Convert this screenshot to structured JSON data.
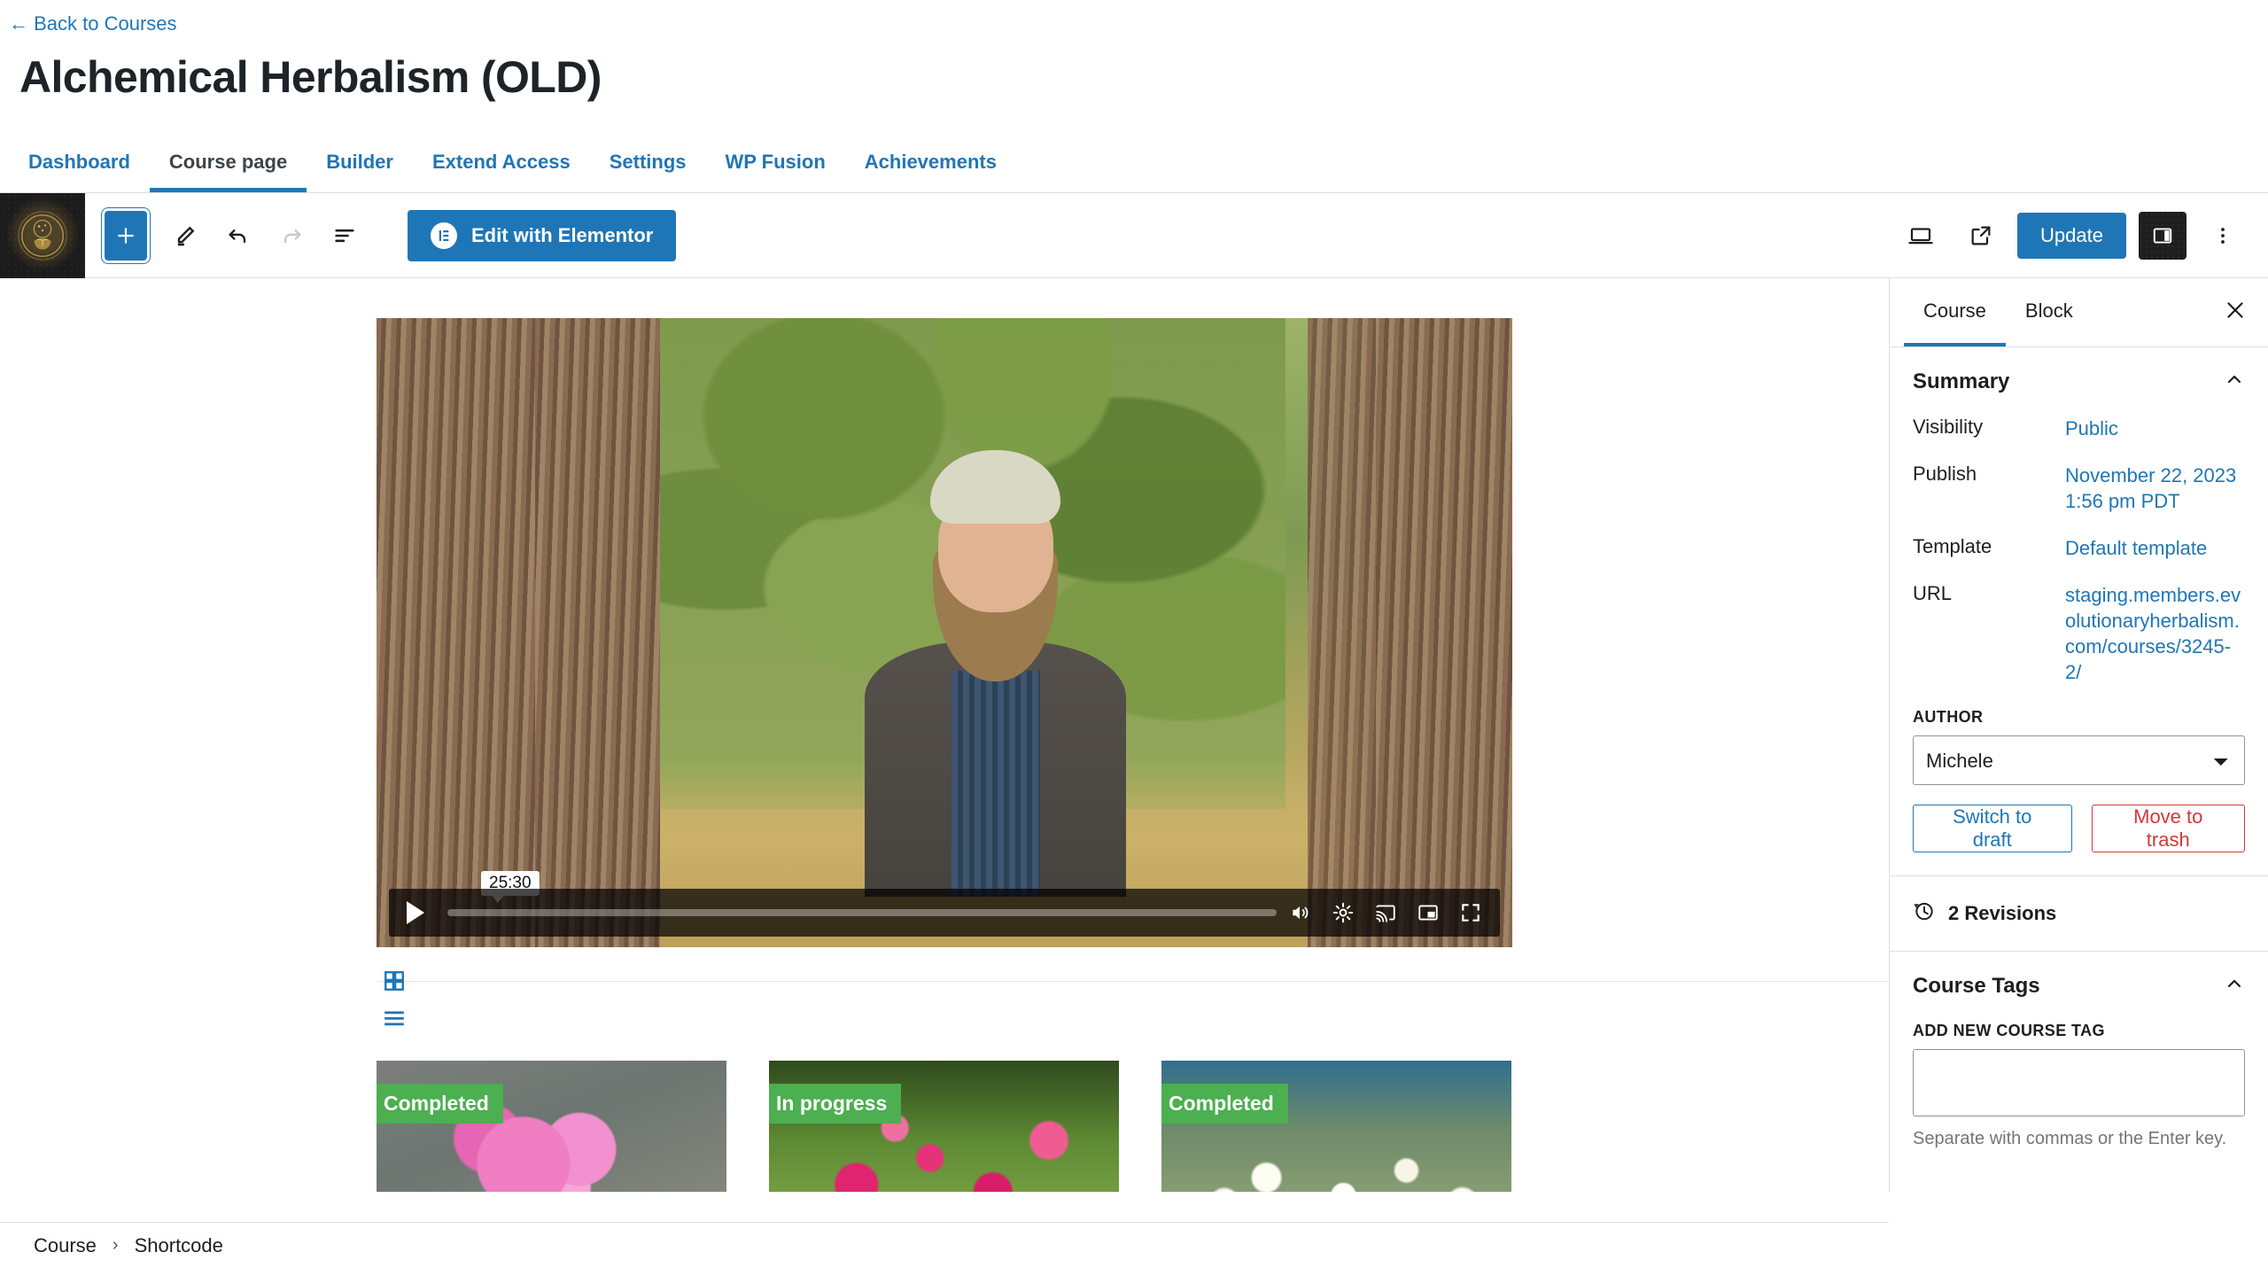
{
  "admin": {
    "back_link": "← Back to Courses",
    "page_title": "Alchemical Herbalism (OLD)",
    "tabs": [
      {
        "label": "Dashboard",
        "active": false
      },
      {
        "label": "Course page",
        "active": true
      },
      {
        "label": "Builder",
        "active": false
      },
      {
        "label": "Extend Access",
        "active": false
      },
      {
        "label": "Settings",
        "active": false
      },
      {
        "label": "WP Fusion",
        "active": false
      },
      {
        "label": "Achievements",
        "active": false
      }
    ]
  },
  "toolbar": {
    "site_icon_name": "site-emblem-icon",
    "add_block_label": "+",
    "tools": [
      "add-block-icon",
      "edit-pencil-icon",
      "undo-icon",
      "redo-icon",
      "list-view-icon"
    ],
    "elementor_button": "Edit with Elementor",
    "preview_icon": "desktop-preview-icon",
    "view_icon": "external-link-icon",
    "update_button": "Update",
    "sidebar_toggle_icon": "settings-sidebar-icon",
    "options_icon": "more-options-icon"
  },
  "canvas": {
    "video": {
      "time_label": "25:30",
      "play_icon": "play-icon",
      "controls": [
        "volume-icon",
        "settings-gear-icon",
        "cast-icon",
        "picture-in-picture-icon",
        "fullscreen-icon"
      ]
    },
    "block_marks": [
      "grid-block-icon",
      "list-block-icon"
    ],
    "cards": [
      {
        "badge": "Completed",
        "photo": "peony"
      },
      {
        "badge": "In progress",
        "photo": "roses"
      },
      {
        "badge": "Completed",
        "photo": "chamomile"
      }
    ]
  },
  "sidebar": {
    "tabs": [
      {
        "label": "Course",
        "active": true
      },
      {
        "label": "Block",
        "active": false
      }
    ],
    "close_icon": "close-icon",
    "summary": {
      "title": "Summary",
      "rows": [
        {
          "label": "Visibility",
          "value": "Public"
        },
        {
          "label": "Publish",
          "value": "November 22, 2023 1:56 pm PDT"
        },
        {
          "label": "Template",
          "value": "Default template"
        },
        {
          "label": "URL",
          "value": "staging.members.evolutionaryherbalism.com/courses/3245-2/"
        }
      ],
      "author_label": "AUTHOR",
      "author_value": "Michele",
      "switch_draft_button": "Switch to draft",
      "move_trash_button": "Move to trash"
    },
    "revisions": {
      "icon": "revision-clock-icon",
      "label": "2 Revisions"
    },
    "course_tags": {
      "title": "Course Tags",
      "add_label": "ADD NEW COURSE TAG",
      "input_value": "",
      "help_text": "Separate with commas or the Enter key."
    }
  },
  "footer": {
    "breadcrumb": [
      {
        "label": "Course"
      },
      {
        "label": "Shortcode"
      }
    ],
    "separator": "›"
  },
  "colors": {
    "accent_blue": "#1f76b6",
    "danger_red": "#d63638",
    "badge_green": "#4caf50"
  }
}
